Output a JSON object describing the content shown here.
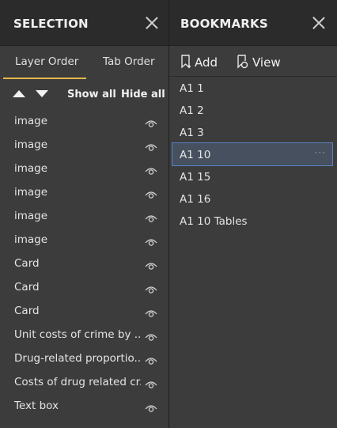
{
  "selection": {
    "title": "SELECTION",
    "tabs": [
      {
        "label": "Layer Order"
      },
      {
        "label": "Tab Order"
      }
    ],
    "active_tab": "Layer Order",
    "toolbar": {
      "show_all": "Show all",
      "hide_all": "Hide all"
    },
    "layers": [
      {
        "label": "image"
      },
      {
        "label": "image"
      },
      {
        "label": "image"
      },
      {
        "label": "image"
      },
      {
        "label": "image"
      },
      {
        "label": "image"
      },
      {
        "label": "Card"
      },
      {
        "label": "Card"
      },
      {
        "label": "Card"
      },
      {
        "label": "Unit costs of crime by ..."
      },
      {
        "label": "Drug-related proportio..."
      },
      {
        "label": "Costs of drug related cr..."
      },
      {
        "label": "Text box"
      }
    ]
  },
  "bookmarks": {
    "title": "BOOKMARKS",
    "toolbar": {
      "add": "Add",
      "view": "View"
    },
    "items": [
      {
        "label": "A1 1"
      },
      {
        "label": "A1 2"
      },
      {
        "label": "A1 3"
      },
      {
        "label": "A1 10",
        "selected": true,
        "more": "···"
      },
      {
        "label": "A1 15"
      },
      {
        "label": "A1 16"
      },
      {
        "label": "A1 10 Tables"
      }
    ]
  },
  "colors": {
    "tab_accent": "#e8b64b",
    "selection_outline": "#5a84c4"
  }
}
